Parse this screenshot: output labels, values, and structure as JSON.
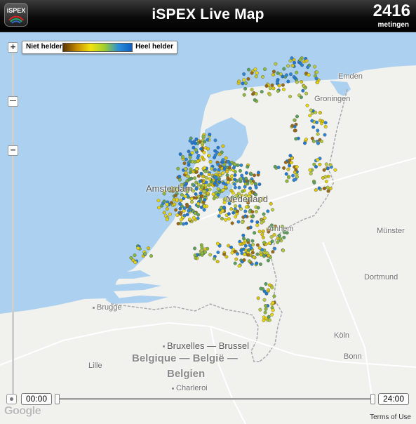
{
  "header": {
    "title": "iSPEX Live Map",
    "logo_text": "iSPEX",
    "count": "2416",
    "count_label": "metingen"
  },
  "legend": {
    "low_label": "Niet helder",
    "high_label": "Heel helder",
    "gradient_colors": [
      "#5a3300",
      "#c58c00",
      "#f2e30c",
      "#9fd02e",
      "#2c8fd6",
      "#0d5fc4"
    ]
  },
  "map": {
    "colors": {
      "sea": "#abd0f0",
      "land": "#f1f1ee",
      "border": "#a9a9a9",
      "road": "#ffffff"
    },
    "places": {
      "emden": "Emden",
      "groningen": "Groningen",
      "amsterdam": "Amsterdam",
      "nederland": "Nederland",
      "arnhem": "Arnhem",
      "munster": "Münster",
      "dortmund": "Dortmund",
      "brugge": "Brugge",
      "koln": "Köln",
      "bruxelles": "Bruxelles — Brussel",
      "lille": "Lille",
      "bonn": "Bonn",
      "belgique": "Belgique — België —",
      "belgien": "Belgien",
      "charleroi": "Charleroi"
    },
    "measurement_colors": [
      "#1e78d2",
      "#2a86d8",
      "#e8d60c",
      "#d9c40a",
      "#b9c93a",
      "#8ab83a",
      "#5aa05a",
      "#9b6a10"
    ]
  },
  "slider": {
    "start_time": "00:00",
    "end_time": "24:00"
  },
  "footer": {
    "google": "Google",
    "terms": "Terms of Use"
  }
}
